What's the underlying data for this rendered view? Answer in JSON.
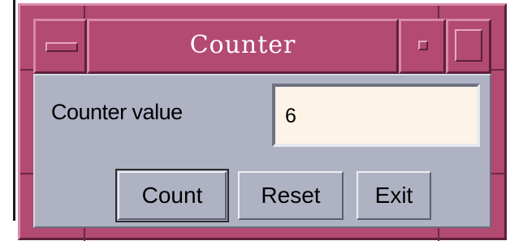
{
  "window": {
    "title": "Counter"
  },
  "form": {
    "counter_label": "Counter value",
    "counter_value": "6"
  },
  "buttons": {
    "count": "Count",
    "reset": "Reset",
    "exit": "Exit"
  },
  "colors": {
    "frame": "#b24a72",
    "client_bg": "#aeb2c3",
    "field_bg": "#fdf3e7",
    "title_text": "#ffffff"
  },
  "icons": {
    "window_menu": "window-menu-icon",
    "minimize": "minimize-icon",
    "maximize": "maximize-icon"
  }
}
